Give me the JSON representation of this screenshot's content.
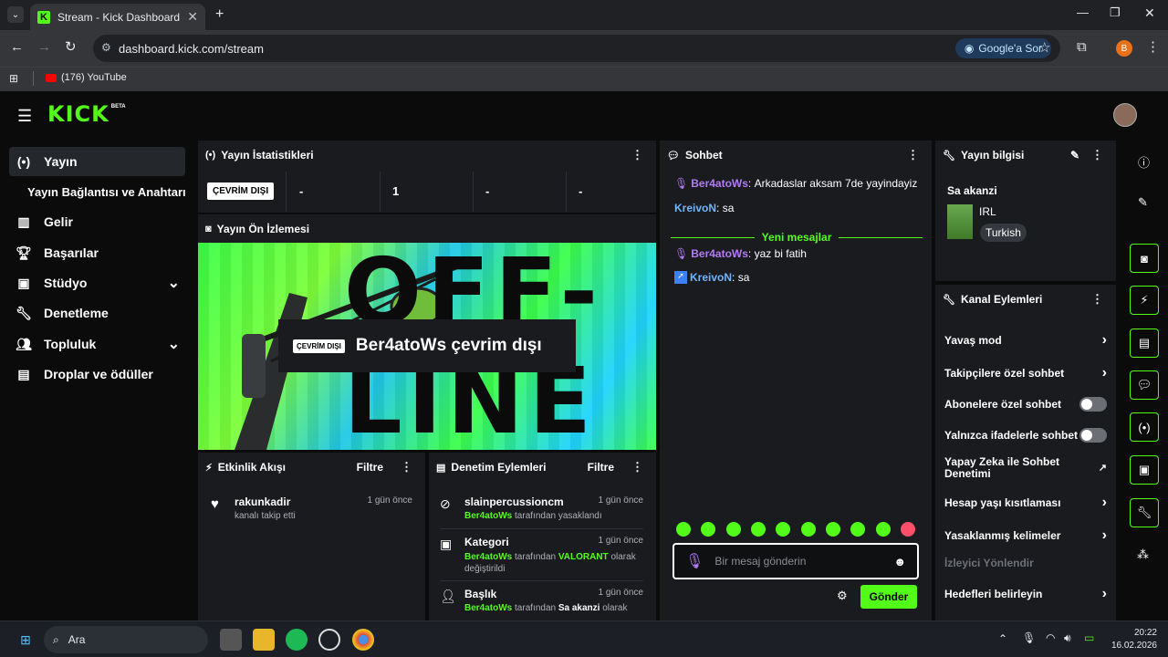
{
  "browser": {
    "tab_title": "Stream - Kick Dashboard",
    "tab_favicon": "K",
    "url": "dashboard.kick.com/stream",
    "google_btn": "Google'a Sor",
    "profile_initial": "B",
    "bookmark": "(176) YouTube"
  },
  "brand": {
    "logo": "KICK",
    "badge": "BETA",
    "accent": "#53fc18"
  },
  "sidebar": {
    "items": [
      {
        "label": "Yayın",
        "icon": "broadcast-icon"
      },
      {
        "label": "Yayın Bağlantısı ve Anahtarı",
        "icon": ""
      },
      {
        "label": "Gelir",
        "icon": "chart-icon"
      },
      {
        "label": "Başarılar",
        "icon": "trophy-icon"
      },
      {
        "label": "Stüdyo",
        "icon": "studio-icon"
      },
      {
        "label": "Denetleme",
        "icon": "wrench-icon"
      },
      {
        "label": "Topluluk",
        "icon": "people-icon"
      },
      {
        "label": "Droplar ve ödüller",
        "icon": "gift-icon"
      }
    ]
  },
  "stats": {
    "title": "Yayın İstatistikleri",
    "status": "ÇEVRİM DIŞI",
    "values": [
      "-",
      "1",
      "-",
      "-"
    ]
  },
  "preview": {
    "title": "Yayın Ön İzlemesi",
    "badge": "ÇEVRİM DIŞI",
    "message": "Ber4atoWs çevrim dışı",
    "bg_text": "OFF-LINE"
  },
  "activity": {
    "title": "Etkinlik Akışı",
    "filter": "Filtre",
    "items": [
      {
        "user": "rakunkadir",
        "time": "1 gün önce",
        "desc": "kanalı takip etti"
      }
    ]
  },
  "moderation": {
    "title": "Denetim Eylemleri",
    "filter": "Filtre",
    "items": [
      {
        "title": "slainpercussioncm",
        "time": "1 gün önce",
        "by": "Ber4atoWs",
        "desc": "tarafından yasaklandı",
        "extra": "",
        "extra2": ""
      },
      {
        "title": "Kategori",
        "time": "1 gün önce",
        "by": "Ber4atoWs",
        "desc": "tarafından",
        "extra": "VALORANT",
        "extra2": "olarak değiştirildi"
      },
      {
        "title": "Başlık",
        "time": "1 gün önce",
        "by": "Ber4atoWs",
        "desc": "tarafından",
        "extra": "Sa akanzi",
        "extra2": "olarak"
      }
    ]
  },
  "chat": {
    "title": "Sohbet",
    "messages": [
      {
        "user": "Ber4atoWs",
        "text": "Arkadaslar aksam 7de yayindayiz",
        "color": "#b37cf5"
      },
      {
        "user": "KreivoN",
        "text": "sa",
        "color": "#6fb6ff"
      }
    ],
    "divider": "Yeni mesajlar",
    "new_messages": [
      {
        "user": "Ber4atoWs",
        "text": "yaz bi fatih",
        "color": "#b37cf5"
      },
      {
        "user": "KreivoN",
        "text": "sa",
        "color": "#6fb6ff"
      }
    ],
    "placeholder": "Bir mesaj gönderin",
    "send": "Gönder"
  },
  "info": {
    "title": "Yayın bilgisi",
    "stream_title": "Sa akanzi",
    "category": "IRL",
    "language": "Turkish"
  },
  "channel_actions": {
    "title": "Kanal Eylemleri",
    "items": [
      {
        "label": "Yavaş mod",
        "control": "chevron"
      },
      {
        "label": "Takipçilere özel sohbet",
        "control": "chevron"
      },
      {
        "label": "Abonelere özel sohbet",
        "control": "toggle"
      },
      {
        "label": "Yalnızca ifadelerle sohbet",
        "control": "toggle"
      },
      {
        "label": "Yapay Zeka ile Sohbet Denetimi",
        "control": "external"
      },
      {
        "label": "Hesap yaşı kısıtlaması",
        "control": "chevron"
      },
      {
        "label": "Yasaklanmış kelimeler",
        "control": "chevron"
      },
      {
        "label": "İzleyici Yönlendir",
        "control": "none"
      },
      {
        "label": "Hedefleri belirleyin",
        "control": "chevron"
      }
    ]
  },
  "taskbar": {
    "search": "Ara",
    "time": "20:22",
    "date": "16.02.2026"
  }
}
